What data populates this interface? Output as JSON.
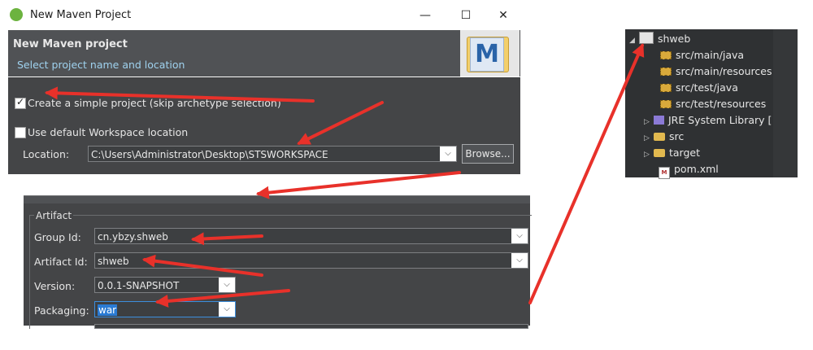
{
  "window": {
    "title": "New Maven Project",
    "minimize": "—",
    "maximize": "☐",
    "close": "✕"
  },
  "header": {
    "title": "New Maven project",
    "subtitle": "Select project name and location",
    "logo_letter": "M"
  },
  "options": {
    "simple_project_label": "Create a simple project (skip archetype selection)",
    "simple_project_checked": true,
    "default_workspace_label": "Use default Workspace location",
    "default_workspace_checked": false,
    "location_label": "Location:",
    "location_value": "C:\\Users\\Administrator\\Desktop\\STSWORKSPACE",
    "browse_label": "Browse..."
  },
  "artifact": {
    "legend": "Artifact",
    "group_id_label": "Group Id:",
    "group_id_value": "cn.ybzy.shweb",
    "artifact_id_label": "Artifact Id:",
    "artifact_id_value": "shweb",
    "version_label": "Version:",
    "version_value": "0.0.1-SNAPSHOT",
    "packaging_label": "Packaging:",
    "packaging_value": "war"
  },
  "explorer": {
    "project": "shweb",
    "items": [
      "src/main/java",
      "src/main/resources",
      "src/test/java",
      "src/test/resources",
      "JRE System Library [",
      "src",
      "target",
      "pom.xml"
    ]
  },
  "colors": {
    "dialog_bg": "#444547",
    "header_bg": "#505255",
    "subtitle": "#9fd2ef",
    "arrow": "#e8312a",
    "explorer_bg": "#2f3133"
  }
}
